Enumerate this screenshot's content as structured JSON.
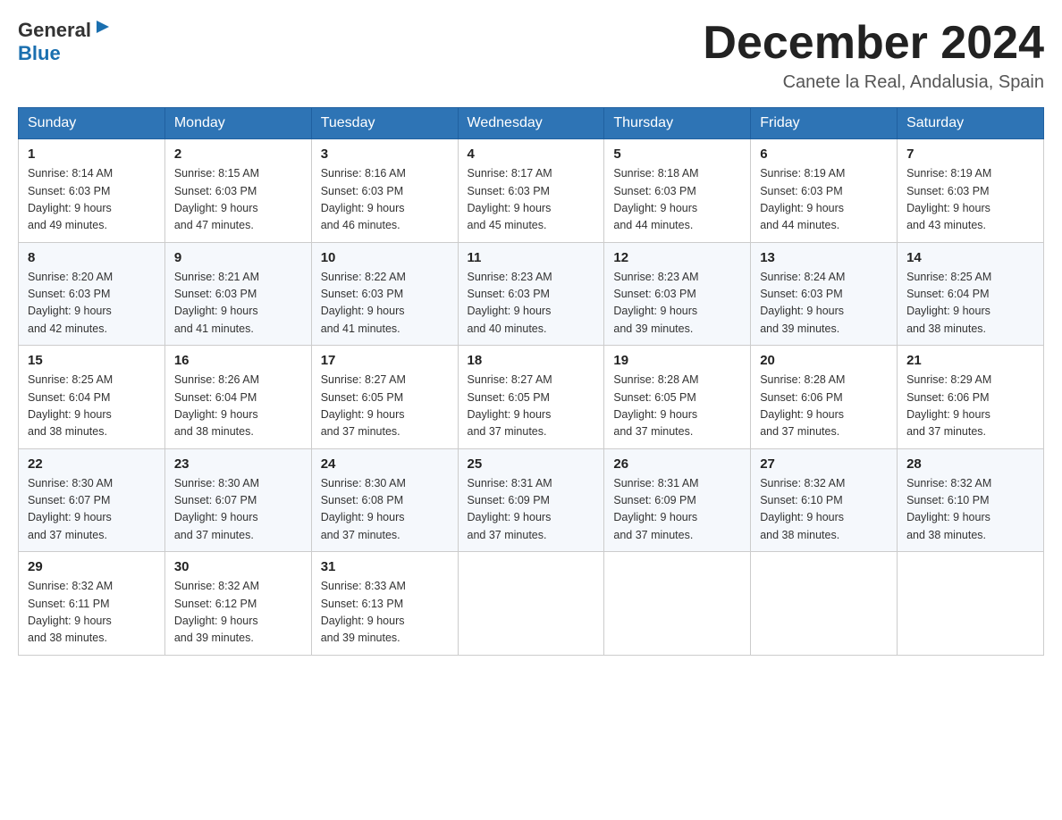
{
  "header": {
    "logo_general": "General",
    "logo_blue": "Blue",
    "month_title": "December 2024",
    "location": "Canete la Real, Andalusia, Spain"
  },
  "weekdays": [
    "Sunday",
    "Monday",
    "Tuesday",
    "Wednesday",
    "Thursday",
    "Friday",
    "Saturday"
  ],
  "weeks": [
    [
      {
        "day": "1",
        "sunrise": "8:14 AM",
        "sunset": "6:03 PM",
        "daylight": "9 hours and 49 minutes."
      },
      {
        "day": "2",
        "sunrise": "8:15 AM",
        "sunset": "6:03 PM",
        "daylight": "9 hours and 47 minutes."
      },
      {
        "day": "3",
        "sunrise": "8:16 AM",
        "sunset": "6:03 PM",
        "daylight": "9 hours and 46 minutes."
      },
      {
        "day": "4",
        "sunrise": "8:17 AM",
        "sunset": "6:03 PM",
        "daylight": "9 hours and 45 minutes."
      },
      {
        "day": "5",
        "sunrise": "8:18 AM",
        "sunset": "6:03 PM",
        "daylight": "9 hours and 44 minutes."
      },
      {
        "day": "6",
        "sunrise": "8:19 AM",
        "sunset": "6:03 PM",
        "daylight": "9 hours and 44 minutes."
      },
      {
        "day": "7",
        "sunrise": "8:19 AM",
        "sunset": "6:03 PM",
        "daylight": "9 hours and 43 minutes."
      }
    ],
    [
      {
        "day": "8",
        "sunrise": "8:20 AM",
        "sunset": "6:03 PM",
        "daylight": "9 hours and 42 minutes."
      },
      {
        "day": "9",
        "sunrise": "8:21 AM",
        "sunset": "6:03 PM",
        "daylight": "9 hours and 41 minutes."
      },
      {
        "day": "10",
        "sunrise": "8:22 AM",
        "sunset": "6:03 PM",
        "daylight": "9 hours and 41 minutes."
      },
      {
        "day": "11",
        "sunrise": "8:23 AM",
        "sunset": "6:03 PM",
        "daylight": "9 hours and 40 minutes."
      },
      {
        "day": "12",
        "sunrise": "8:23 AM",
        "sunset": "6:03 PM",
        "daylight": "9 hours and 39 minutes."
      },
      {
        "day": "13",
        "sunrise": "8:24 AM",
        "sunset": "6:03 PM",
        "daylight": "9 hours and 39 minutes."
      },
      {
        "day": "14",
        "sunrise": "8:25 AM",
        "sunset": "6:04 PM",
        "daylight": "9 hours and 38 minutes."
      }
    ],
    [
      {
        "day": "15",
        "sunrise": "8:25 AM",
        "sunset": "6:04 PM",
        "daylight": "9 hours and 38 minutes."
      },
      {
        "day": "16",
        "sunrise": "8:26 AM",
        "sunset": "6:04 PM",
        "daylight": "9 hours and 38 minutes."
      },
      {
        "day": "17",
        "sunrise": "8:27 AM",
        "sunset": "6:05 PM",
        "daylight": "9 hours and 37 minutes."
      },
      {
        "day": "18",
        "sunrise": "8:27 AM",
        "sunset": "6:05 PM",
        "daylight": "9 hours and 37 minutes."
      },
      {
        "day": "19",
        "sunrise": "8:28 AM",
        "sunset": "6:05 PM",
        "daylight": "9 hours and 37 minutes."
      },
      {
        "day": "20",
        "sunrise": "8:28 AM",
        "sunset": "6:06 PM",
        "daylight": "9 hours and 37 minutes."
      },
      {
        "day": "21",
        "sunrise": "8:29 AM",
        "sunset": "6:06 PM",
        "daylight": "9 hours and 37 minutes."
      }
    ],
    [
      {
        "day": "22",
        "sunrise": "8:30 AM",
        "sunset": "6:07 PM",
        "daylight": "9 hours and 37 minutes."
      },
      {
        "day": "23",
        "sunrise": "8:30 AM",
        "sunset": "6:07 PM",
        "daylight": "9 hours and 37 minutes."
      },
      {
        "day": "24",
        "sunrise": "8:30 AM",
        "sunset": "6:08 PM",
        "daylight": "9 hours and 37 minutes."
      },
      {
        "day": "25",
        "sunrise": "8:31 AM",
        "sunset": "6:09 PM",
        "daylight": "9 hours and 37 minutes."
      },
      {
        "day": "26",
        "sunrise": "8:31 AM",
        "sunset": "6:09 PM",
        "daylight": "9 hours and 37 minutes."
      },
      {
        "day": "27",
        "sunrise": "8:32 AM",
        "sunset": "6:10 PM",
        "daylight": "9 hours and 38 minutes."
      },
      {
        "day": "28",
        "sunrise": "8:32 AM",
        "sunset": "6:10 PM",
        "daylight": "9 hours and 38 minutes."
      }
    ],
    [
      {
        "day": "29",
        "sunrise": "8:32 AM",
        "sunset": "6:11 PM",
        "daylight": "9 hours and 38 minutes."
      },
      {
        "day": "30",
        "sunrise": "8:32 AM",
        "sunset": "6:12 PM",
        "daylight": "9 hours and 39 minutes."
      },
      {
        "day": "31",
        "sunrise": "8:33 AM",
        "sunset": "6:13 PM",
        "daylight": "9 hours and 39 minutes."
      },
      null,
      null,
      null,
      null
    ]
  ]
}
